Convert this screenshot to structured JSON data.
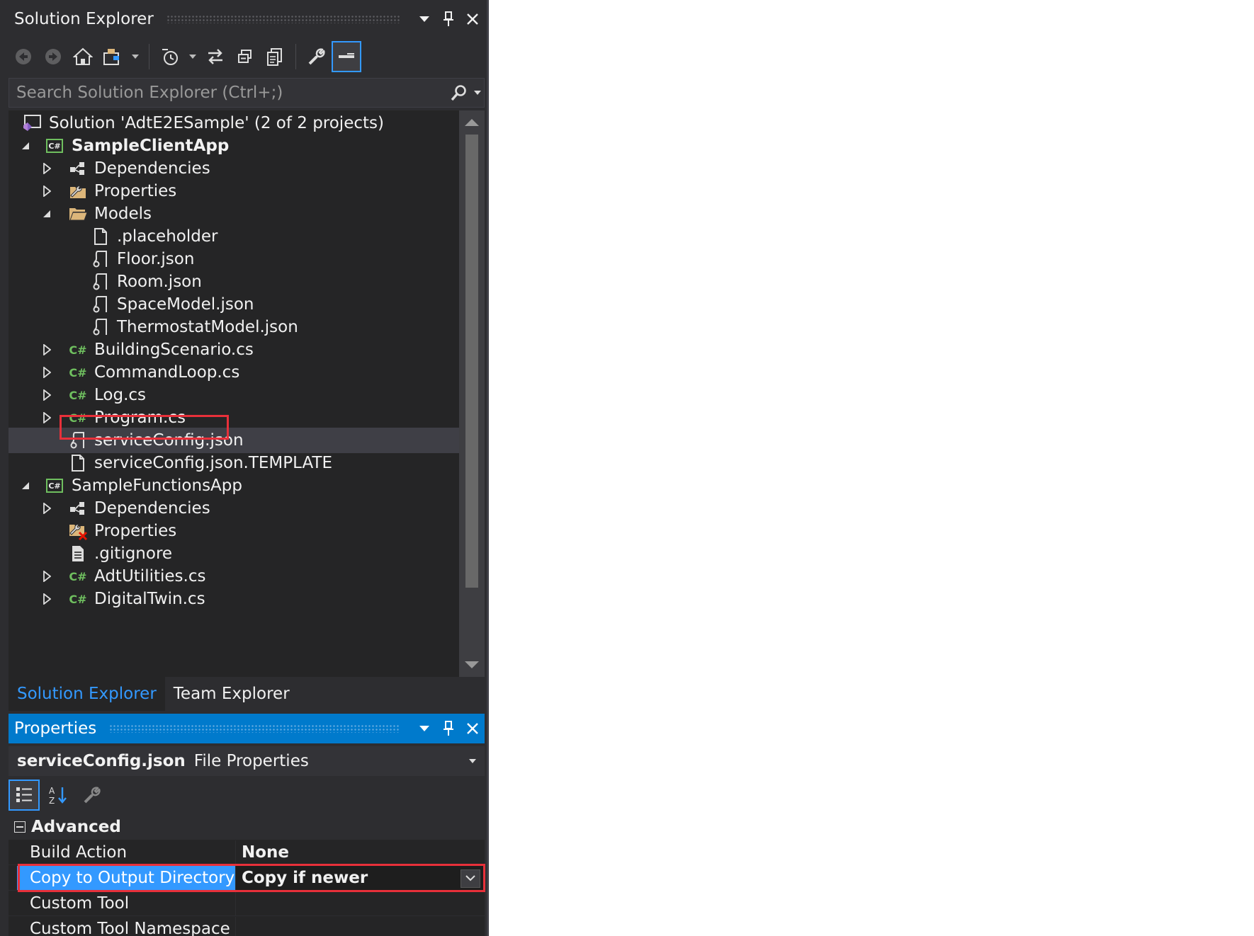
{
  "solution_explorer": {
    "title": "Solution Explorer",
    "search_placeholder": "Search Solution Explorer (Ctrl+;)",
    "tree": {
      "solution": "Solution 'AdtE2ESample' (2 of 2 projects)",
      "project1": "SampleClientApp",
      "dependencies1": "Dependencies",
      "properties1": "Properties",
      "models": "Models",
      "placeholder": ".placeholder",
      "floor": "Floor.json",
      "room": "Room.json",
      "spacemodel": "SpaceModel.json",
      "thermostat": "ThermostatModel.json",
      "building": "BuildingScenario.cs",
      "commandloop": "CommandLoop.cs",
      "log": "Log.cs",
      "program": "Program.cs",
      "serviceconfig": "serviceConfig.json",
      "serviceconfig_template": "serviceConfig.json.TEMPLATE",
      "project2": "SampleFunctionsApp",
      "dependencies2": "Dependencies",
      "properties2": "Properties",
      "gitignore": ".gitignore",
      "adtutilities": "AdtUtilities.cs",
      "digitaltwin": "DigitalTwin.cs"
    },
    "tabs": {
      "solution_explorer": "Solution Explorer",
      "team_explorer": "Team Explorer"
    }
  },
  "properties_panel": {
    "title": "Properties",
    "object_name": "serviceConfig.json",
    "object_type": "File Properties",
    "category": "Advanced",
    "rows": [
      {
        "name": "Build Action",
        "value": "None"
      },
      {
        "name": "Copy to Output Directory",
        "value": "Copy if newer"
      },
      {
        "name": "Custom Tool",
        "value": ""
      },
      {
        "name": "Custom Tool Namespace",
        "value": ""
      }
    ]
  },
  "colors": {
    "accent": "#007acc",
    "highlight": "#e8303a",
    "selection": "#3399ff",
    "background": "#2d2d30",
    "tree_background": "#252526"
  }
}
